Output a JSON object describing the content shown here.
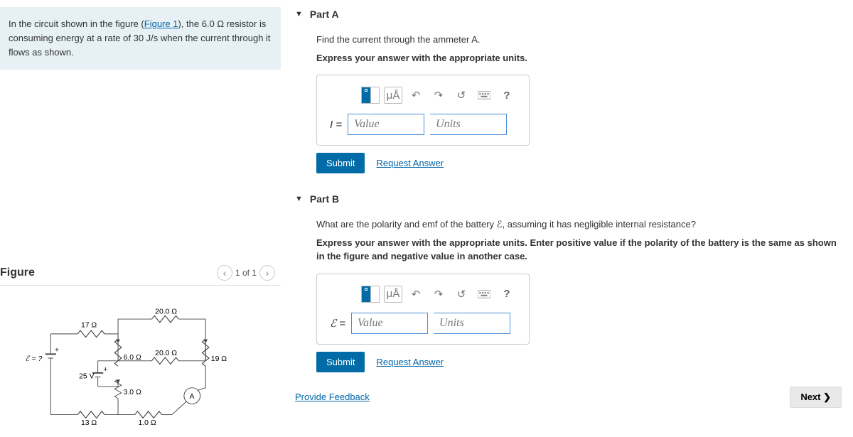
{
  "problem": {
    "text_before_link": "In the circuit shown in the figure (",
    "link_text": "Figure 1",
    "text_after_link": "), the 6.0 Ω resistor is consuming energy at a rate of 30 J/s when the current through it flows as shown."
  },
  "figure": {
    "title": "Figure",
    "pager_text": "1 of 1",
    "labels": {
      "r17": "17 Ω",
      "r20a": "20.0 Ω",
      "r6": "6.0 Ω",
      "r20b": "20.0 Ω",
      "r19": "19 Ω",
      "v25": "25 V",
      "r3": "3.0 Ω",
      "r13": "13 Ω",
      "r1": "1.0 Ω",
      "ammeter": "A",
      "eps": "ℰ = ?"
    }
  },
  "partA": {
    "header": "Part A",
    "prompt": "Find the current through the ammeter A.",
    "instruction": "Express your answer with the appropriate units.",
    "var": "I =",
    "value_ph": "Value",
    "units_ph": "Units",
    "submit": "Submit",
    "request": "Request Answer",
    "mu": "μÅ",
    "help": "?"
  },
  "partB": {
    "header": "Part B",
    "prompt": "What are the polarity and emf of the battery ℰ, assuming it has negligible internal resistance?",
    "instruction": "Express your answer with the appropriate units. Enter positive value if the polarity of the battery is the same as shown in the figure and negative value in another case.",
    "var": "ℰ =",
    "value_ph": "Value",
    "units_ph": "Units",
    "submit": "Submit",
    "request": "Request Answer",
    "mu": "μÅ",
    "help": "?"
  },
  "footer": {
    "feedback": "Provide Feedback",
    "next": "Next ❯"
  }
}
